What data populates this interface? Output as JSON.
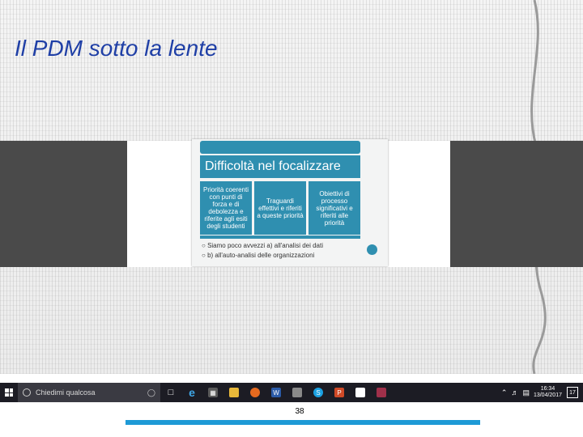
{
  "slide_title": "Il PDM  sotto la lente",
  "embedded_slide": {
    "heading": "Difficoltà nel focalizzare",
    "cells": [
      "Priorità coerenti con punti di forza e di debolezza e riferite agli esiti degli studenti",
      "Traguardi effettivi e riferiti a queste priorità",
      "Obiettivi di processo significativi e riferiti alle priorità"
    ],
    "bullets": [
      "Siamo poco avvezzi a) all'analisi dei dati",
      "b) all'auto-analisi delle organizzazioni"
    ],
    "accent_color": "#2f8fb0"
  },
  "taskbar": {
    "search_placeholder": "Chiedimi qualcosa",
    "clock_time": "16:34",
    "clock_date": "13/04/2017",
    "notification_count": "17",
    "icons": [
      "start-icon",
      "task-view-icon",
      "edge-icon",
      "store-icon",
      "explorer-icon",
      "firefox-icon",
      "word-icon",
      "image-icon",
      "skype-icon",
      "powerpoint-icon",
      "photos-icon",
      "media-icon"
    ]
  },
  "page_number": "38",
  "colors": {
    "title": "#1f3fa6",
    "bottom_bar": "#1e9ad6",
    "taskbar": "#1c1c24"
  }
}
